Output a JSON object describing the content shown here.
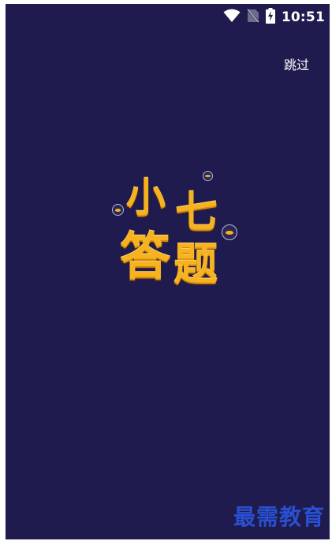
{
  "status_bar": {
    "time": "10:51",
    "icons": [
      "wifi-icon",
      "no-sim-icon",
      "battery-charging-icon"
    ]
  },
  "splash": {
    "skip_label": "跳过",
    "logo": {
      "chars": [
        "小",
        "七",
        "答",
        "题"
      ]
    },
    "background_color": "#1f1b4e",
    "accent_color": "#f6b21f"
  },
  "watermark": {
    "text": "最需教育",
    "color": "#2a4fd0"
  }
}
